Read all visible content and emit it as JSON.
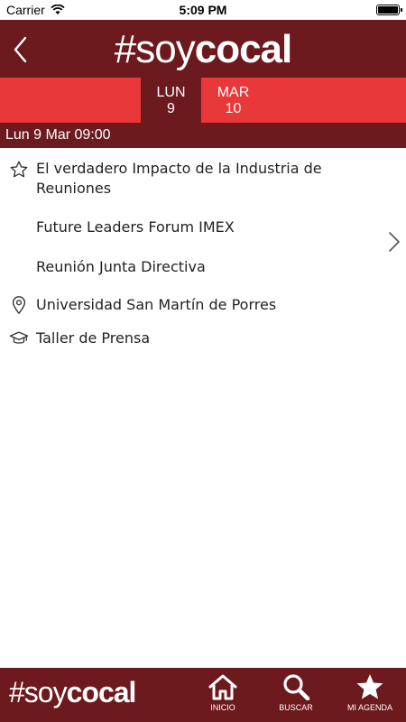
{
  "status_bar": {
    "carrier": "Carrier",
    "time": "5:09 PM"
  },
  "header": {
    "logo_prefix": "#soy",
    "logo_suffix": "cocal"
  },
  "day_tabs": [
    {
      "day": "LUN",
      "num": "9",
      "active": true
    },
    {
      "day": "MAR",
      "num": "10",
      "active": false
    }
  ],
  "time_band": "Lun 9 Mar 09:00",
  "items": [
    {
      "icon": "star-outline-icon",
      "text": "El verdadero Impacto de la Industria de Reuniones"
    },
    {
      "icon": "",
      "text": "Future Leaders Forum IMEX"
    },
    {
      "icon": "",
      "text": "Reunión Junta Directiva"
    },
    {
      "icon": "location-pin-icon",
      "text": "Universidad San Martín de Porres"
    },
    {
      "icon": "graduation-cap-icon",
      "text": "Taller de Prensa"
    }
  ],
  "bottom_bar": {
    "logo_prefix": "#soy",
    "logo_suffix": "cocal",
    "tabs": [
      {
        "icon": "home-icon",
        "label": "INICIO"
      },
      {
        "icon": "search-icon",
        "label": "BUSCAR"
      },
      {
        "icon": "star-icon",
        "label": "MI AGENDA"
      }
    ]
  },
  "colors": {
    "primary": "#6d1a1e",
    "accent": "#e8383a",
    "background": "#ffffff"
  }
}
